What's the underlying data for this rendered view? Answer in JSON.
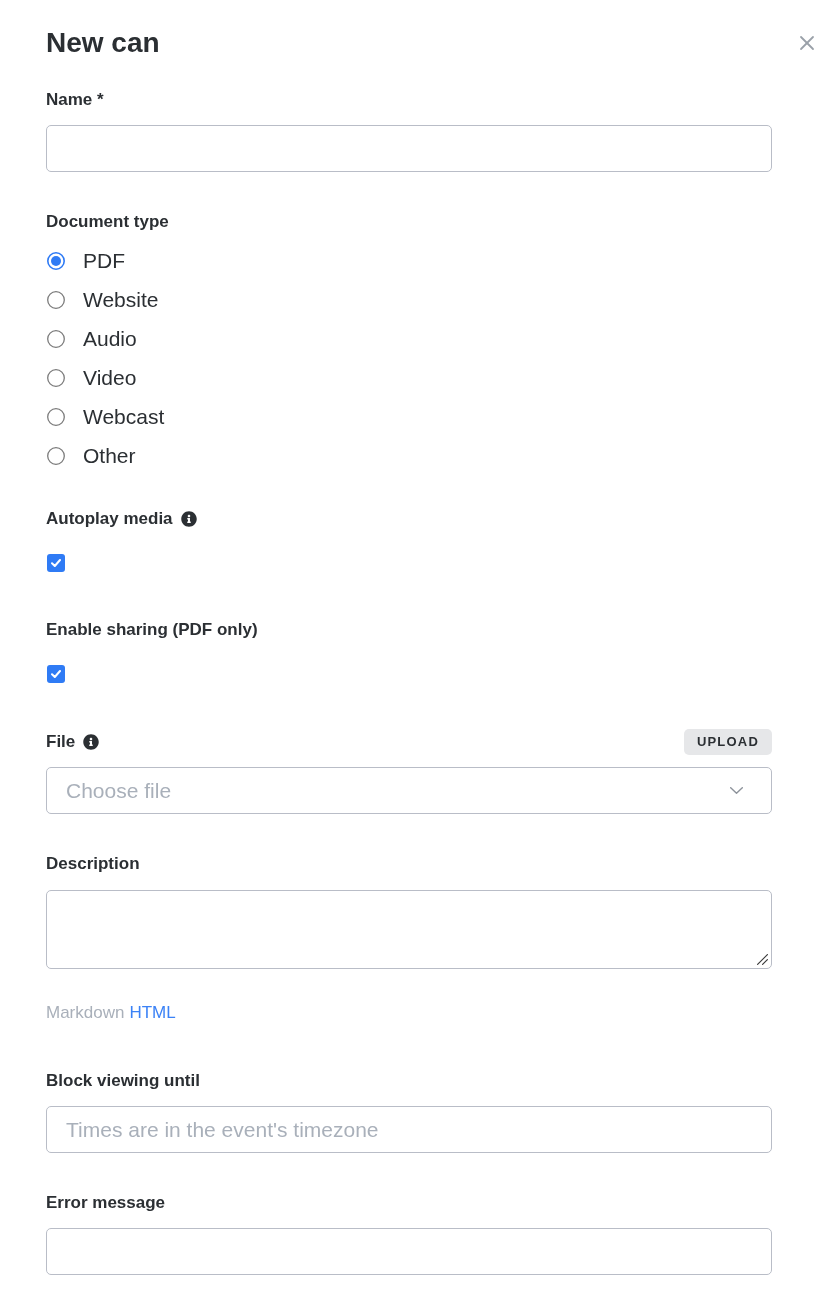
{
  "dialog": {
    "title": "New can"
  },
  "fields": [
    {
      "kind": "text",
      "label": "Name *"
    },
    {
      "kind": "radio_group",
      "label": "Document type",
      "options": [
        {
          "label": "PDF",
          "selected": true
        },
        {
          "label": "Website",
          "selected": false
        },
        {
          "label": "Audio",
          "selected": false
        },
        {
          "label": "Video",
          "selected": false
        },
        {
          "label": "Webcast",
          "selected": false
        },
        {
          "label": "Other",
          "selected": false
        }
      ]
    },
    {
      "kind": "checkbox",
      "label": "Autoplay media",
      "info": true,
      "checked": true
    },
    {
      "kind": "checkbox",
      "label": "Enable sharing (PDF only)",
      "info": false,
      "checked": true
    },
    {
      "kind": "select",
      "label": "File",
      "info": true,
      "action": "UPLOAD",
      "placeholder": "Choose file"
    },
    {
      "kind": "textarea",
      "label": "Description",
      "formats": [
        {
          "label": "Markdown",
          "selected": true
        },
        {
          "label": "HTML",
          "selected": false
        }
      ]
    },
    {
      "kind": "text",
      "label": "Block viewing until",
      "placeholder": "Times are in the event's timezone"
    },
    {
      "kind": "text",
      "label": "Error message"
    }
  ]
}
